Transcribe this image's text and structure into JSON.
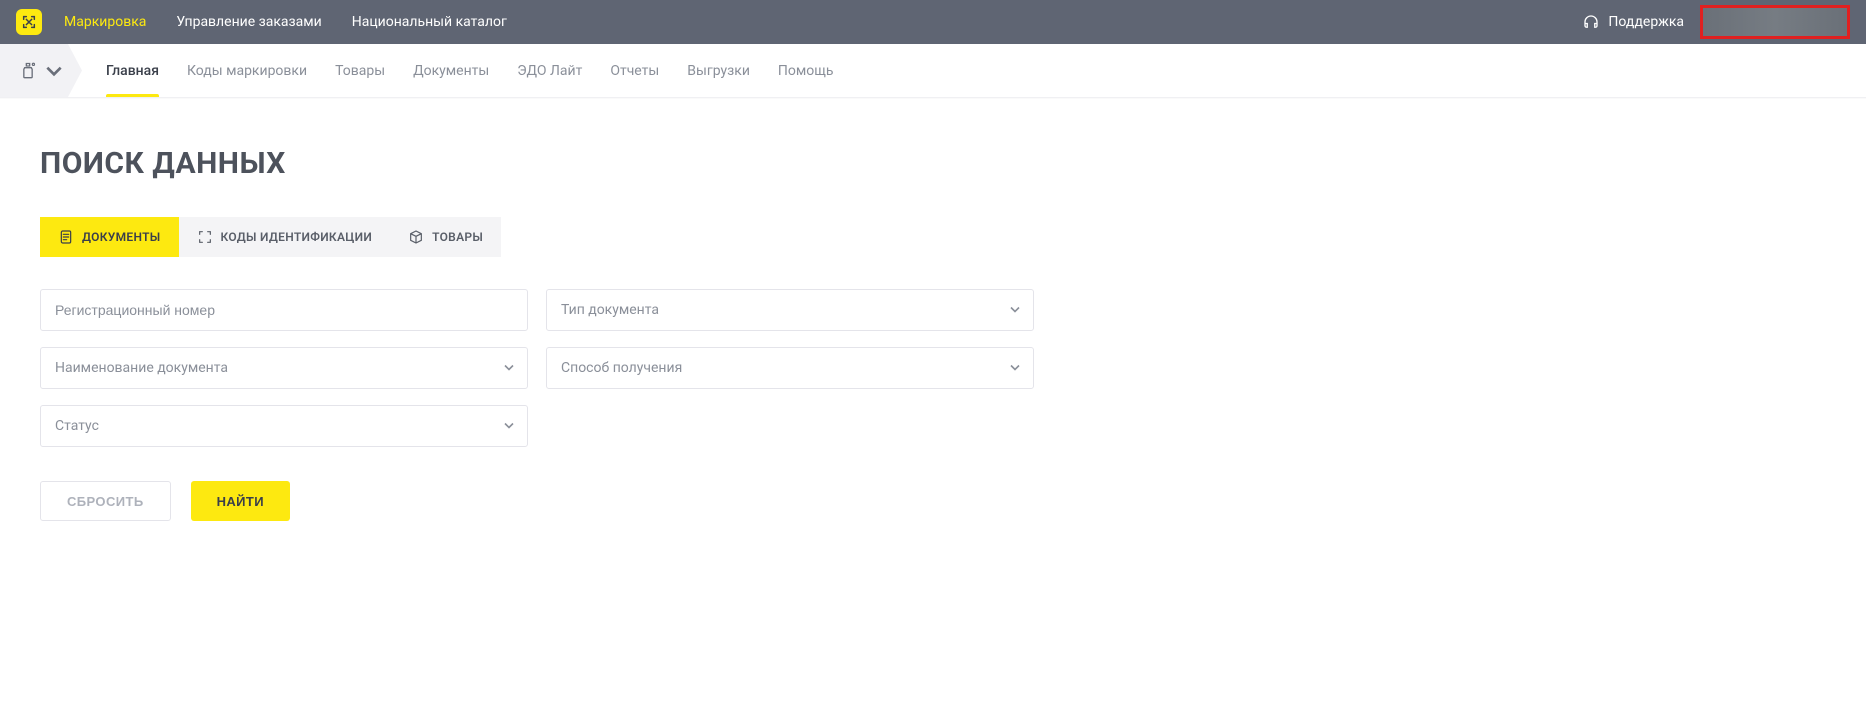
{
  "header": {
    "nav": [
      {
        "label": "Маркировка",
        "active": true
      },
      {
        "label": "Управление заказами",
        "active": false
      },
      {
        "label": "Национальный каталог",
        "active": false
      }
    ],
    "support_label": "Поддержка"
  },
  "subnav": {
    "tabs": [
      {
        "label": "Главная",
        "active": true
      },
      {
        "label": "Коды маркировки",
        "active": false
      },
      {
        "label": "Товары",
        "active": false
      },
      {
        "label": "Документы",
        "active": false
      },
      {
        "label": "ЭДО Лайт",
        "active": false
      },
      {
        "label": "Отчеты",
        "active": false
      },
      {
        "label": "Выгрузки",
        "active": false
      },
      {
        "label": "Помощь",
        "active": false
      }
    ]
  },
  "page": {
    "title": "ПОИСК ДАННЫХ"
  },
  "filter_tabs": [
    {
      "label": "ДОКУМЕНТЫ",
      "active": true
    },
    {
      "label": "КОДЫ ИДЕНТИФИКАЦИИ",
      "active": false
    },
    {
      "label": "ТОВАРЫ",
      "active": false
    }
  ],
  "form": {
    "reg_number_placeholder": "Регистрационный номер",
    "doc_type_placeholder": "Тип документа",
    "doc_name_placeholder": "Наименование документа",
    "receive_method_placeholder": "Способ получения",
    "status_placeholder": "Статус",
    "reset_label": "СБРОСИТЬ",
    "search_label": "НАЙТИ"
  }
}
